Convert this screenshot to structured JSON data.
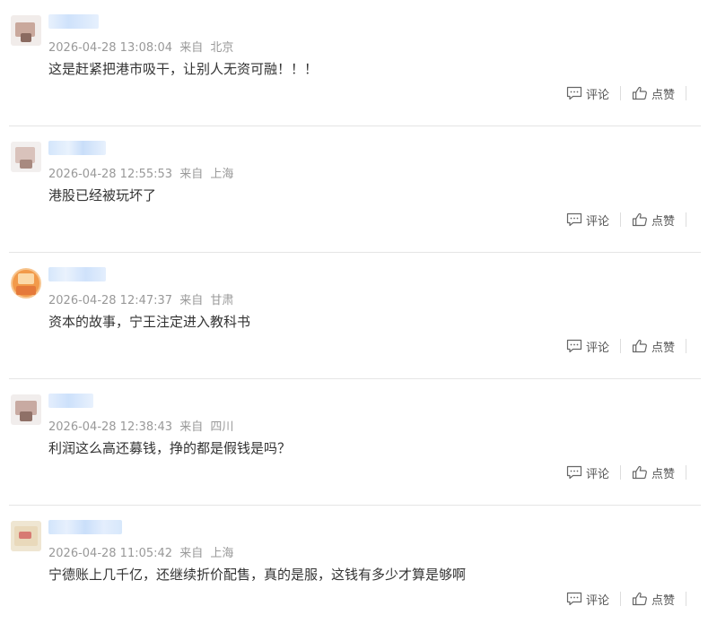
{
  "comments": [
    {
      "time": "2026-04-28 13:08:04",
      "from_label": "来自",
      "location": "北京",
      "content": "这是赶紧把港市吸干，让别人无资可融！！！",
      "comment_label": "评论",
      "like_label": "点赞"
    },
    {
      "time": "2026-04-28 12:55:53",
      "from_label": "来自",
      "location": "上海",
      "content": "港股已经被玩坏了",
      "comment_label": "评论",
      "like_label": "点赞"
    },
    {
      "time": "2026-04-28 12:47:37",
      "from_label": "来自",
      "location": "甘肃",
      "content": "资本的故事，宁王注定进入教科书",
      "comment_label": "评论",
      "like_label": "点赞"
    },
    {
      "time": "2026-04-28 12:38:43",
      "from_label": "来自",
      "location": "四川",
      "content": "利润这么高还募钱，挣的都是假钱是吗？",
      "comment_label": "评论",
      "like_label": "点赞"
    },
    {
      "time": "2026-04-28 11:05:42",
      "from_label": "来自",
      "location": "上海",
      "content": "宁德账上几千亿，还继续折价配售，真的是服，这钱有多少才算是够啊",
      "comment_label": "评论",
      "like_label": "点赞"
    }
  ],
  "icons": {
    "comment": "comment-icon",
    "like": "thumbs-up-icon"
  },
  "colors": {
    "text": "#333333",
    "meta": "#999999",
    "action": "#555555",
    "divider": "#e5e5e5",
    "username_blur": "#d6e6fb"
  }
}
